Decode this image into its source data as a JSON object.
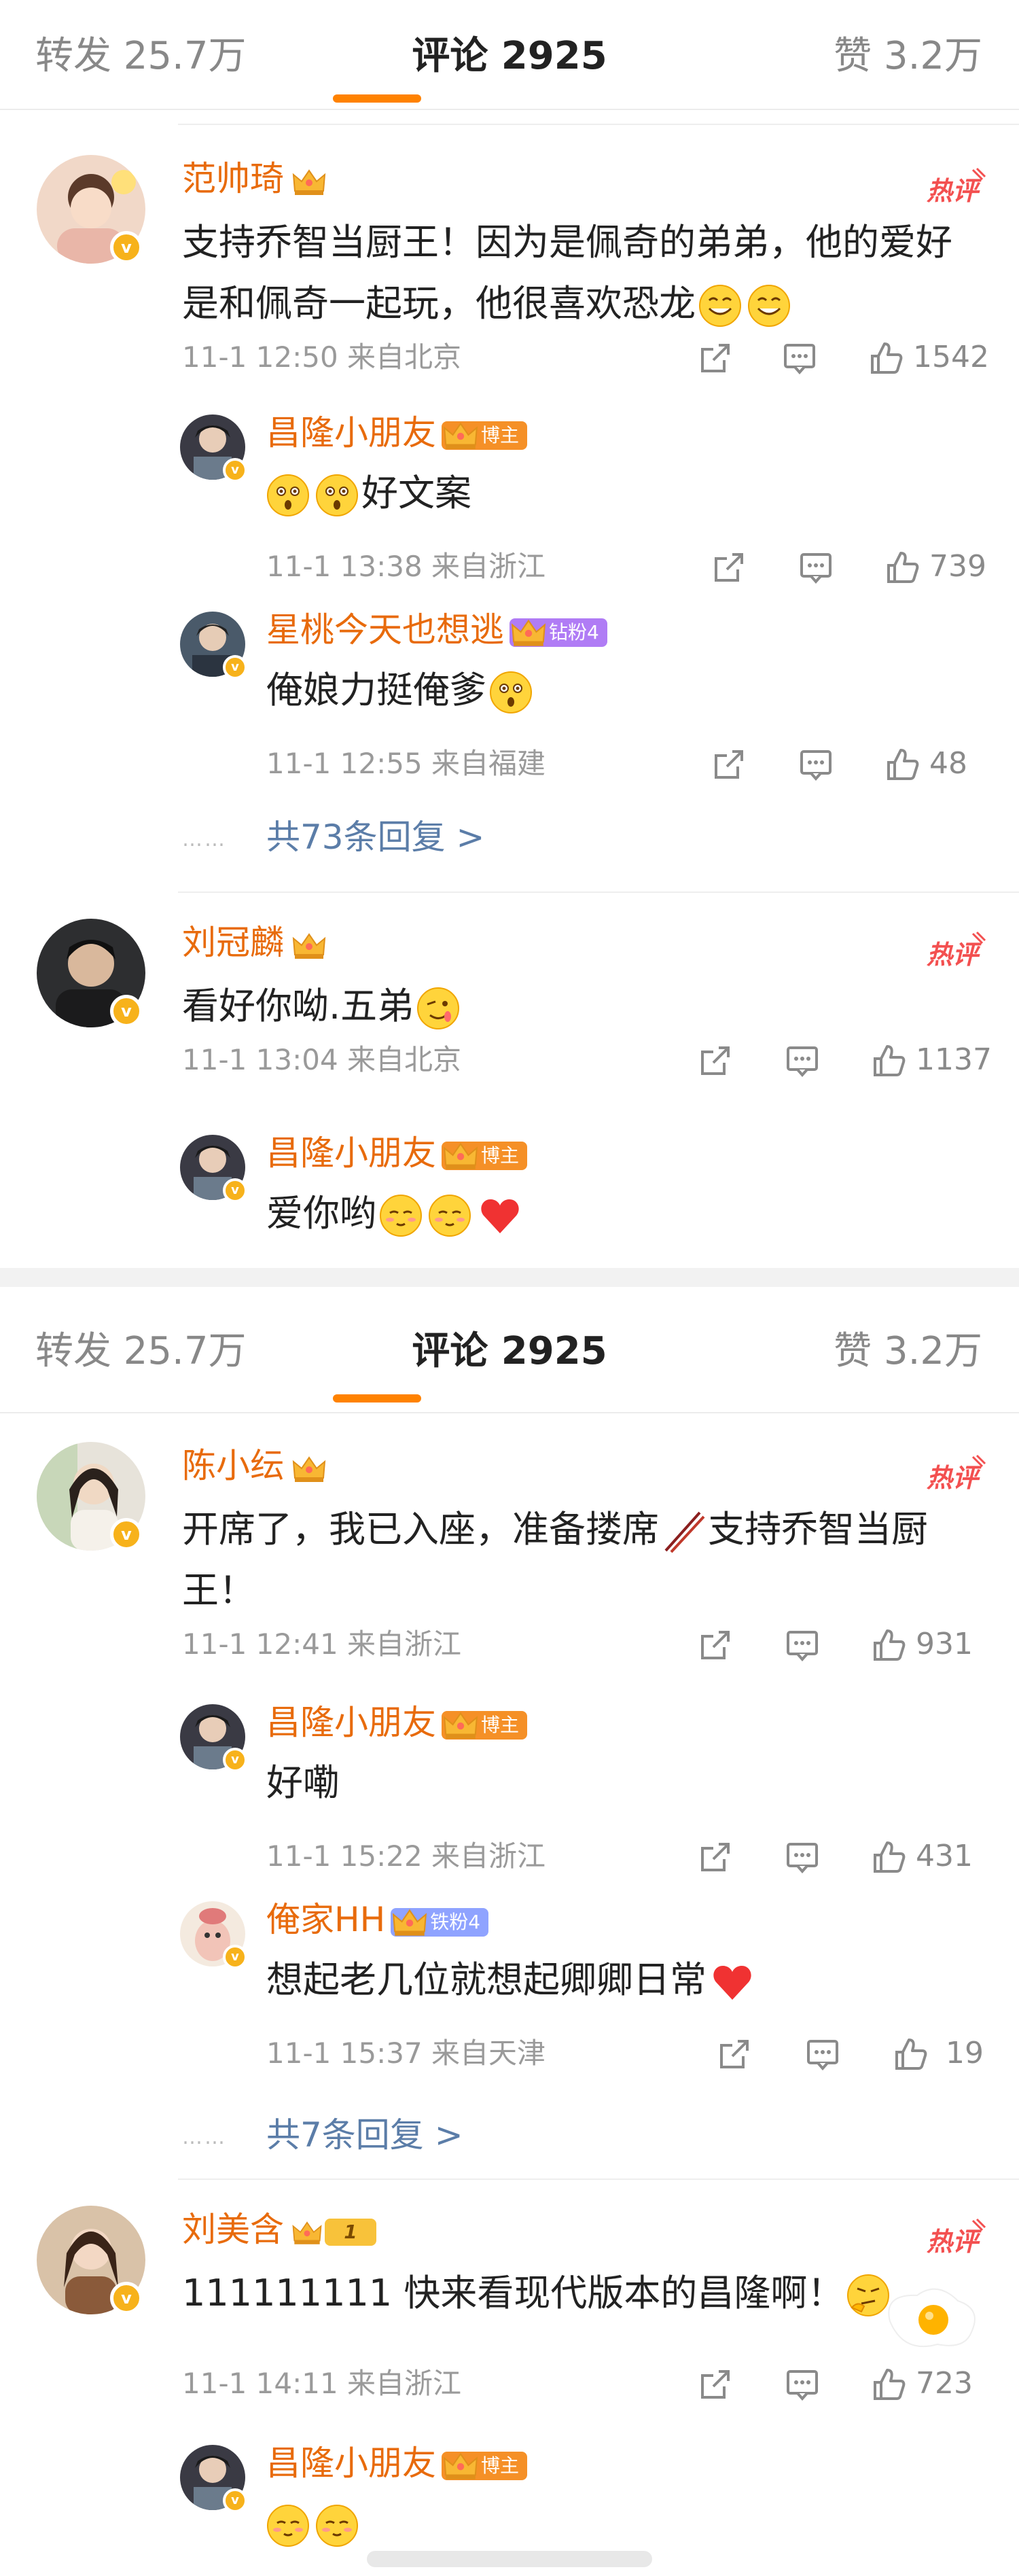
{
  "tabs_top": {
    "repost": "转发 25.7万",
    "comments": "评论 2925",
    "likes": "赞 3.2万"
  },
  "tabs_mid": {
    "repost": "转发 25.7万",
    "comments": "评论 2925",
    "likes": "赞 3.2万"
  },
  "hot_label": "热评",
  "badges": {
    "v": "v",
    "bozhu": "博主",
    "zuanfen": "钻粉4",
    "tiefen": "铁粉4",
    "level": "1"
  },
  "c1": {
    "name": "范帅琦",
    "text": "支持乔智当厨王！因为是佩奇的弟弟，他的爱好是和佩奇一起玩，他很喜欢恐龙",
    "meta": "11-1 12:50 来自北京",
    "likes": "1542",
    "r1": {
      "name": "昌隆小朋友",
      "text": "好文案",
      "meta": "11-1 13:38 来自浙江",
      "likes": "739"
    },
    "r2": {
      "name": "星桃今天也想逃",
      "text": "俺娘力挺俺爹",
      "meta": "11-1 12:55 来自福建",
      "likes": "48"
    },
    "more": "共73条回复 >"
  },
  "c2": {
    "name": "刘冠麟",
    "text": "看好你呦.五弟",
    "meta": "11-1 13:04 来自北京",
    "likes": "1137",
    "r1": {
      "name": "昌隆小朋友",
      "text": "爱你哟"
    }
  },
  "c3": {
    "name": "陈小纭",
    "text": "开席了，我已入座，准备搂席",
    "text2": "支持乔智当厨王！",
    "meta": "11-1 12:41 来自浙江",
    "likes": "931",
    "r1": {
      "name": "昌隆小朋友",
      "text": "好嘞",
      "meta": "11-1 15:22 来自浙江",
      "likes": "431"
    },
    "r2": {
      "name": "俺家HH",
      "text": "想起老几位就想起卿卿日常",
      "meta": "11-1 15:37 来自天津",
      "likes": "19"
    },
    "more": "共7条回复 >"
  },
  "c4": {
    "name": "刘美含",
    "text": "111111111  快来看现代版本的昌隆啊！",
    "meta": "11-1 14:11 来自浙江",
    "likes": "723",
    "r1": {
      "name": "昌隆小朋友"
    }
  },
  "dots": "……",
  "icons": [
    "share-icon",
    "comment-icon",
    "like-icon",
    "crown-icon",
    "grinning-emoji",
    "surprised-emoji",
    "smirk-emoji",
    "wink-emoji",
    "blush-emoji",
    "heart-icon",
    "chopsticks-icon",
    "egg-sticker",
    "hot-comment-badge",
    "verified-icon"
  ],
  "colors": {
    "accent": "#ff8200",
    "username": "#e86b0c",
    "link": "#5b7da8",
    "meta": "#9a9a9a",
    "verified": "#f7b21b"
  }
}
